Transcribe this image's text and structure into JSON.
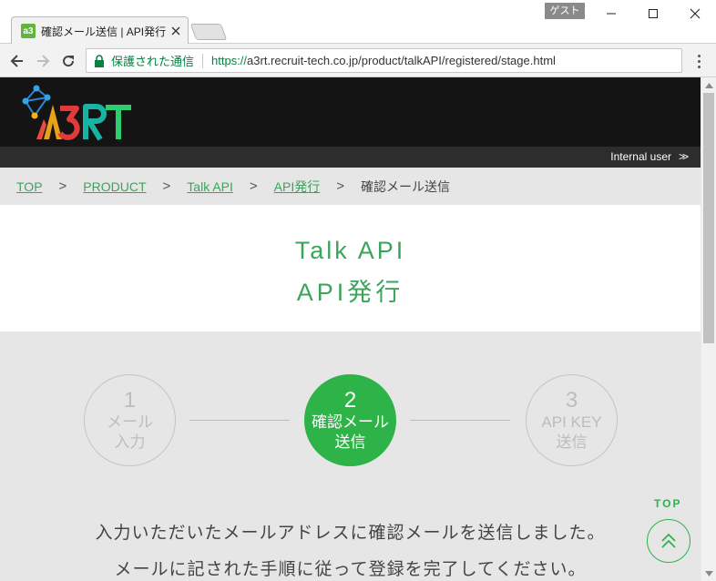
{
  "browser": {
    "guest_label": "ゲスト",
    "tab_favicon": "a3",
    "tab_title": "確認メール送信 | API発行",
    "url_secure_label": "保護された通信",
    "url_scheme": "https://",
    "url_rest": "a3rt.recruit-tech.co.jp/product/talkAPI/registered/stage.html"
  },
  "header": {
    "logo_alt": "A3RT",
    "internal_user_label": "Internal user",
    "internal_user_chevron": ">>"
  },
  "breadcrumb": {
    "items": [
      "TOP",
      "PRODUCT",
      "Talk API",
      "API発行"
    ],
    "separator": ">",
    "current": "確認メール送信"
  },
  "title": {
    "line1": "Talk API",
    "line2": "API発行"
  },
  "steps": [
    {
      "num": "1",
      "label": "メール\n入力",
      "active": false
    },
    {
      "num": "2",
      "label": "確認メール\n送信",
      "active": true
    },
    {
      "num": "3",
      "label": "API KEY\n送信",
      "active": false
    }
  ],
  "message": {
    "line1": "入力いただいたメールアドレスに確認メールを送信しました。",
    "line2": "メールに記された手順に従って登録を完了してください。"
  },
  "page_top": {
    "label": "TOP"
  },
  "colors": {
    "accent": "#2db347",
    "link": "#3aa55a",
    "header_bg": "#141414",
    "subheader_bg": "#2d2d2d",
    "page_bg": "#e6e6e6"
  }
}
